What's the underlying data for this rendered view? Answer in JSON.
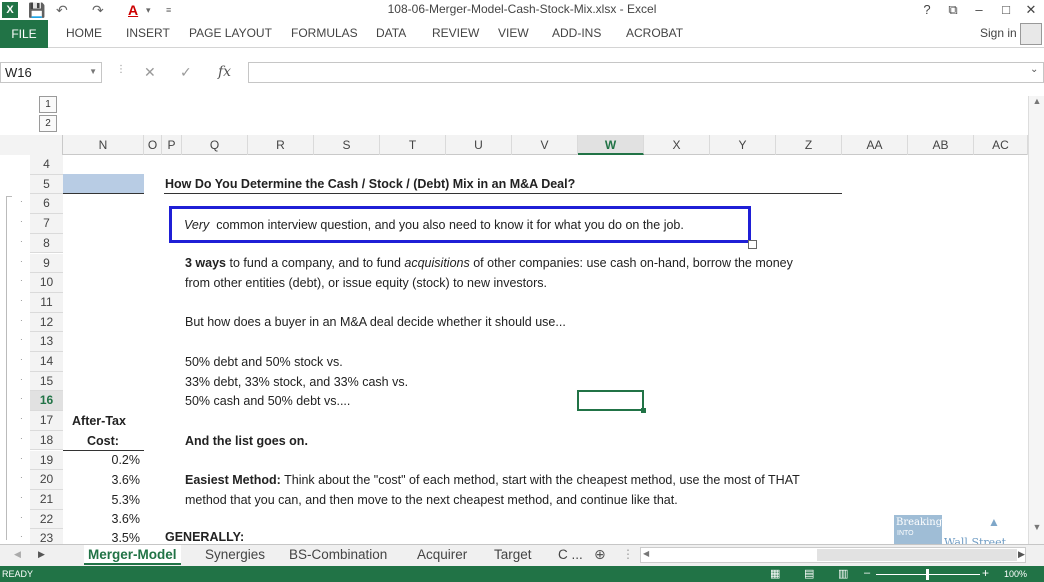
{
  "window": {
    "title": "108-06-Merger-Model-Cash-Stock-Mix.xlsx - Excel",
    "help": "?",
    "restore": "⧉",
    "minimize": "–",
    "maximize": "□",
    "close": "✕"
  },
  "ribbon": {
    "file": "FILE",
    "tabs": [
      "HOME",
      "INSERT",
      "PAGE LAYOUT",
      "FORMULAS",
      "DATA",
      "REVIEW",
      "VIEW",
      "ADD-INS",
      "ACROBAT"
    ],
    "signin": "Sign in"
  },
  "formula_bar": {
    "namebox": "W16",
    "fx": "fx",
    "value": ""
  },
  "outline": {
    "levels": [
      "1",
      "2"
    ]
  },
  "columns": [
    "N",
    "O",
    "P",
    "Q",
    "R",
    "S",
    "T",
    "U",
    "V",
    "W",
    "X",
    "Y",
    "Z",
    "AA",
    "AB",
    "AC"
  ],
  "rows": [
    "4",
    "5",
    "6",
    "7",
    "8",
    "9",
    "10",
    "11",
    "12",
    "13",
    "14",
    "15",
    "16",
    "17",
    "18",
    "19",
    "20",
    "21",
    "22",
    "23"
  ],
  "content": {
    "heading": "How Do You Determine the Cash / Stock / (Debt) Mix in an M&A Deal?",
    "box_italic": "Very",
    "box_text": "common interview question, and you also need to know it for what you do on the job.",
    "r9_bold": "3 ways",
    "r9_text1": "to fund a company, and to fund",
    "r9_italic": "acquisitions",
    "r9_text2": "of other companies: use cash on-hand, borrow the money",
    "r10": "from other entities (debt), or issue equity (stock) to new investors.",
    "r12": "But how does a buyer in an M&A deal decide whether it should use...",
    "r14": "50% debt and 50% stock vs.",
    "r15": "33% debt, 33% stock, and 33% cash vs.",
    "r16": "50% cash and 50% debt vs....",
    "r18": "And the list goes on.",
    "r20_bold": "Easiest Method:",
    "r20_text": "Think about the \"cost\" of each method, start with the cheapest method, use the most of THAT",
    "r21": "method that you can, and then move to the next cheapest method, and continue like that.",
    "r23": "GENERALLY:"
  },
  "column_n": {
    "header1": "After-Tax",
    "header2": "Cost:",
    "values": [
      "0.2%",
      "3.6%",
      "5.3%",
      "3.6%",
      "3.5%"
    ]
  },
  "sheet_tabs": [
    "Merger-Model",
    "Synergies",
    "BS-Combination",
    "Acquirer",
    "Target",
    "C ..."
  ],
  "watermark": {
    "line1": "Breaking",
    "line2": "INTO",
    "line3": "Wall Street"
  },
  "status": {
    "mode": "READY",
    "zoom": "100%"
  },
  "colors": {
    "excel_green": "#217346",
    "box_blue": "#1f1fd6",
    "highlight": "#b8cce4"
  }
}
